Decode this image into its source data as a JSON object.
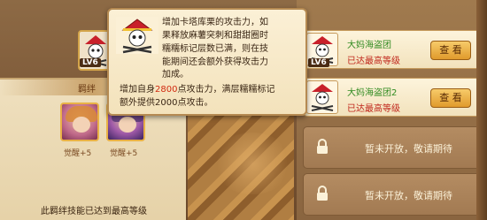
{
  "tooltip": {
    "line1": "增加卡塔库栗的攻击力，如",
    "line2": "果释放麻薯突刺和甜甜圈时",
    "line3": "糯糯标记层数已满，则在技",
    "line4": "能期间还会额外获得攻击力",
    "line5": "加成。",
    "line6_prefix": "增加自身",
    "line6_value": "2800",
    "line6_suffix": "点攻击力，满层糯糯标记",
    "line7": "额外提供2000点攻击。"
  },
  "skill": {
    "level": "LV6"
  },
  "bond_panel": {
    "title": "羁绊",
    "members": [
      {
        "awaken": "觉醒+5"
      },
      {
        "awaken": "觉醒+5"
      }
    ],
    "footer": "此羁绊技能已达到最高等级"
  },
  "cards": [
    {
      "name": "大妈海盗团",
      "status": "已达最高等级",
      "level": "LV6",
      "button": "查 看"
    },
    {
      "name": "大妈海盗团2",
      "status": "已达最高等级",
      "level": "LV6",
      "button": "查 看"
    }
  ],
  "locked": [
    {
      "text": "暂未开放，敬请期待"
    },
    {
      "text": "暂未开放，敬请期待"
    }
  ],
  "colors": {
    "accent_red": "#d12a10",
    "name_green": "#2f8a1f",
    "status_red": "#c0271c"
  },
  "icons": [
    "jolly-roger-icon",
    "lock-icon"
  ]
}
